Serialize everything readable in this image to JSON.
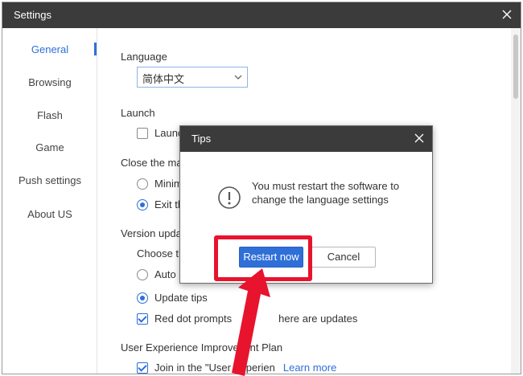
{
  "window": {
    "title": "Settings"
  },
  "sidebar": {
    "items": [
      {
        "label": "General",
        "active": true
      },
      {
        "label": "Browsing",
        "active": false
      },
      {
        "label": "Flash",
        "active": false
      },
      {
        "label": "Game",
        "active": false
      },
      {
        "label": "Push settings",
        "active": false
      },
      {
        "label": "About US",
        "active": false
      }
    ]
  },
  "content": {
    "language": {
      "title": "Language",
      "selected": "简体中文"
    },
    "launch": {
      "title": "Launch",
      "option": "Launc",
      "checked": false
    },
    "close": {
      "title": "Close the ma",
      "options": [
        {
          "label": "Minim",
          "checked": false
        },
        {
          "label": "Exit th",
          "checked": true
        }
      ]
    },
    "version": {
      "title": "Version upda",
      "subtitle": "Choose th",
      "options": [
        {
          "label": "Auto u",
          "checked": false
        },
        {
          "label": "Update tips",
          "checked": true
        }
      ],
      "red_dot": {
        "label": "Red dot prompts",
        "label_tail": "here are updates",
        "checked": true
      }
    },
    "ux_plan": {
      "title": "User Experience Improve",
      "title_tail": "nt Plan",
      "join_label": "Join in the \"User Experien",
      "join_checked": true,
      "learn_more": "Learn more"
    }
  },
  "dialog": {
    "title": "Tips",
    "message": "You must restart the software to change the language settings",
    "primary_button": "Restart now",
    "secondary_button": "Cancel"
  },
  "colors": {
    "accent": "#2f6fd8",
    "titlebar": "#3b3b3b",
    "annotation_red": "#e8132d"
  }
}
